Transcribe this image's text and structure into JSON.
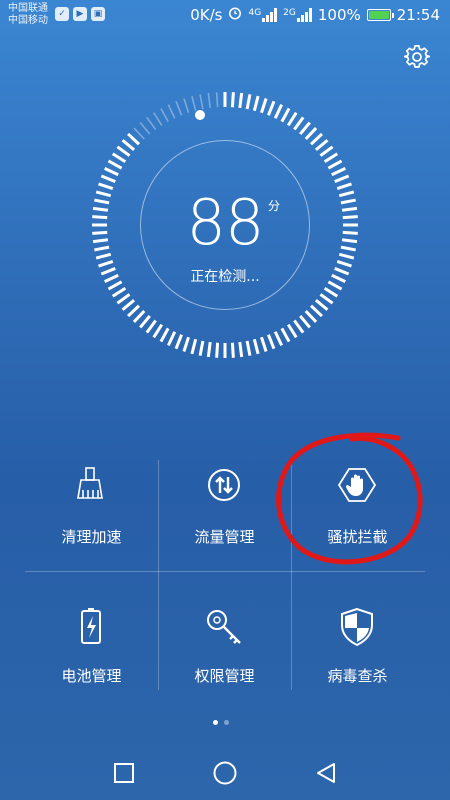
{
  "status_bar": {
    "carrier1": "中国联通",
    "carrier2": "中国移动",
    "speed": "0K/s",
    "net1": "4G",
    "net2": "2G",
    "battery": "100%",
    "time": "21:54"
  },
  "score": {
    "value": "88",
    "unit": "分",
    "status": "正在检测..."
  },
  "tiles": [
    {
      "label": "清理加速",
      "icon": "broom-icon"
    },
    {
      "label": "流量管理",
      "icon": "data-arrows-icon"
    },
    {
      "label": "骚扰拦截",
      "icon": "block-hand-icon"
    },
    {
      "label": "电池管理",
      "icon": "battery-icon"
    },
    {
      "label": "权限管理",
      "icon": "key-icon"
    },
    {
      "label": "病毒查杀",
      "icon": "shield-icon"
    }
  ],
  "pager": {
    "pages": 2,
    "current": 1
  },
  "colors": {
    "background": "#2f6db8",
    "battery_fill": "#52d152",
    "annotation": "#e01818"
  }
}
